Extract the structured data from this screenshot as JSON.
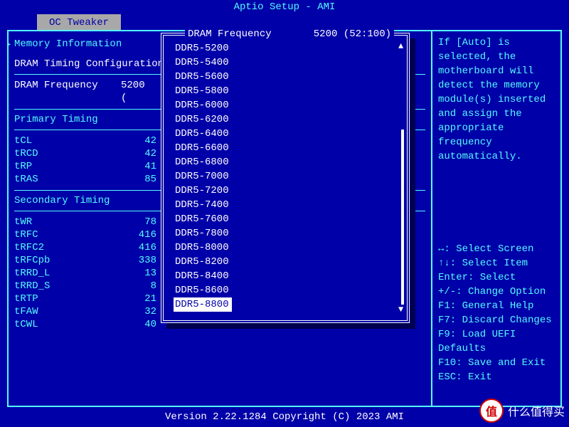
{
  "title": "Aptio Setup - AMI",
  "tab": "OC Tweaker",
  "section_memory": "Memory Information",
  "dram_timing_cfg": "DRAM Timing Configuration",
  "dram_freq_label": "DRAM Frequency",
  "dram_freq_value": "5200 (",
  "primary_timing": "Primary Timing",
  "secondary_timing": "Secondary Timing",
  "timings_primary": [
    {
      "label": "tCL",
      "val": "42"
    },
    {
      "label": "tRCD",
      "val": "42"
    },
    {
      "label": "tRP",
      "val": "41"
    },
    {
      "label": "tRAS",
      "val": "85"
    }
  ],
  "timings_secondary": [
    {
      "label": "tWR",
      "val": "78"
    },
    {
      "label": "tRFC",
      "val": "416"
    },
    {
      "label": "tRFC2",
      "val": "416"
    },
    {
      "label": "tRFCpb",
      "val": "338"
    },
    {
      "label": "tRRD_L",
      "val": "13"
    },
    {
      "label": "tRRD_S",
      "val": "8"
    },
    {
      "label": "tRTP",
      "val": "21"
    },
    {
      "label": "tFAW",
      "val": "32"
    },
    {
      "label": "tCWL",
      "val": "40"
    }
  ],
  "popup": {
    "title": "DRAM Frequency",
    "current": "5200 (52:100)",
    "options": [
      "DDR5-5200",
      "DDR5-5400",
      "DDR5-5600",
      "DDR5-5800",
      "DDR5-6000",
      "DDR5-6200",
      "DDR5-6400",
      "DDR5-6600",
      "DDR5-6800",
      "DDR5-7000",
      "DDR5-7200",
      "DDR5-7400",
      "DDR5-7600",
      "DDR5-7800",
      "DDR5-8000",
      "DDR5-8200",
      "DDR5-8400",
      "DDR5-8600",
      "DDR5-8800"
    ],
    "selected_index": 18
  },
  "help_text": "If [Auto] is selected, the motherboard will detect the memory module(s) inserted and assign the appropriate frequency automatically.",
  "legend": [
    "↔: Select Screen",
    "↑↓: Select Item",
    "Enter: Select",
    "+/-: Change Option",
    "F1: General Help",
    "F7: Discard Changes",
    "F9: Load UEFI Defaults",
    "F10: Save and Exit",
    "ESC: Exit"
  ],
  "footer": "Version 2.22.1284 Copyright (C) 2023 AMI",
  "watermark_badge": "值",
  "watermark_text": "什么值得买"
}
